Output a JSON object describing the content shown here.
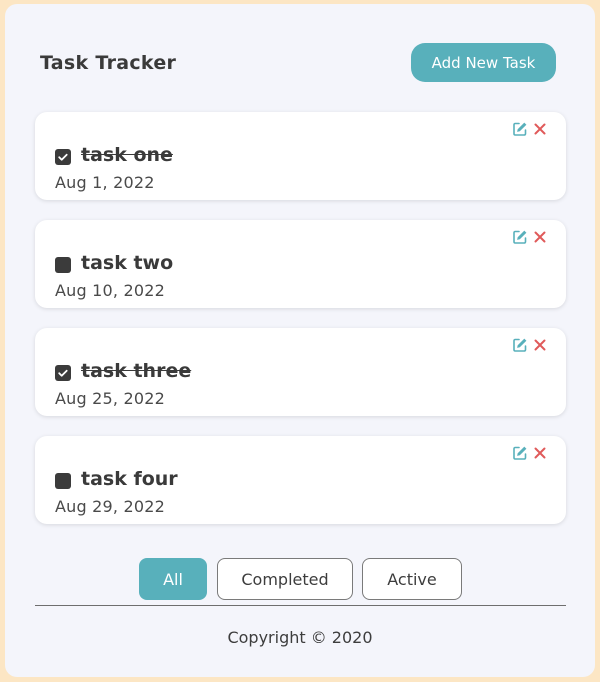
{
  "header": {
    "title": "Task Tracker",
    "add_button_label": "Add New Task"
  },
  "tasks": [
    {
      "name": "task one",
      "date": "Aug 1, 2022",
      "completed": true
    },
    {
      "name": "task two",
      "date": "Aug 10, 2022",
      "completed": false
    },
    {
      "name": "task three",
      "date": "Aug 25, 2022",
      "completed": true
    },
    {
      "name": "task four",
      "date": "Aug 29, 2022",
      "completed": false
    }
  ],
  "task_actions": {
    "edit_icon": "edit-icon",
    "delete_icon": "close-icon"
  },
  "filters": {
    "all_label": "All",
    "completed_label": "Completed",
    "active_label": "Active",
    "selected": "All"
  },
  "footer": {
    "copyright": "Copyright © 2020"
  },
  "colors": {
    "accent": "#58b0bb",
    "delete": "#e05a5a",
    "page_background": "#fce6c4",
    "app_background": "#f4f5fb"
  }
}
